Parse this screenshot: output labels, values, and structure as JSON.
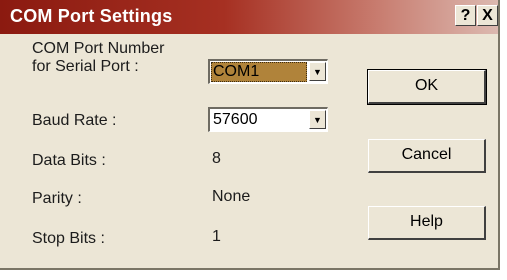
{
  "window": {
    "title": "COM Port Settings",
    "help_glyph": "?",
    "close_glyph": "X"
  },
  "fields": {
    "com_port_label_line1": "COM Port Number",
    "com_port_label_line2": "for Serial Port :",
    "com_port_value": "COM1",
    "baud_label": "Baud Rate :",
    "baud_value": "57600",
    "data_bits_label": "Data Bits :",
    "data_bits_value": "8",
    "parity_label": "Parity :",
    "parity_value": "None",
    "stop_bits_label": "Stop Bits :",
    "stop_bits_value": "1"
  },
  "buttons": {
    "ok": "OK",
    "cancel": "Cancel",
    "help": "Help"
  },
  "icons": {
    "dropdown_arrow": "▼"
  },
  "colors": {
    "titlebar": "#8b1a10",
    "dialog_bg": "#ece6d6",
    "focused_select": "#b0833a"
  }
}
